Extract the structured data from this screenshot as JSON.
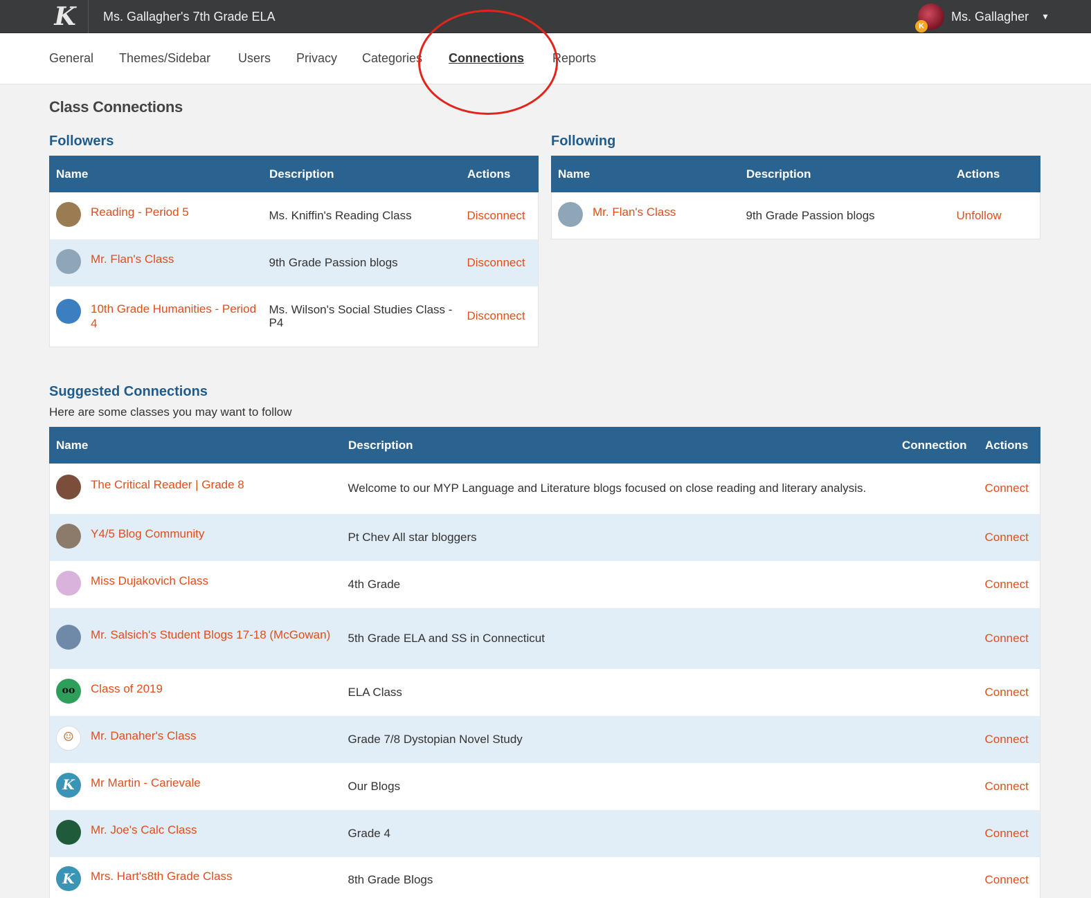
{
  "header": {
    "logo_letter": "K",
    "site_title": "Ms. Gallagher's 7th Grade ELA",
    "user_name": "Ms. Gallagher",
    "badge_letter": "K"
  },
  "nav": {
    "tabs": [
      "General",
      "Themes/Sidebar",
      "Users",
      "Privacy",
      "Categories",
      "Connections",
      "Reports"
    ],
    "active": "Connections"
  },
  "page_title": "Class Connections",
  "followers": {
    "title": "Followers",
    "columns": [
      "Name",
      "Description",
      "Actions"
    ],
    "rows": [
      {
        "name": "Reading - Period 5",
        "description": "Ms. Kniffin's Reading Class",
        "action": "Disconnect",
        "avatar": "book-icon",
        "color": "#9a7b52"
      },
      {
        "name": "Mr. Flan's Class",
        "description": "9th Grade Passion blogs",
        "action": "Disconnect",
        "avatar": "swirl-icon",
        "color": "#8fa6b8"
      },
      {
        "name": "10th Grade Humanities - Period 4",
        "description": "Ms. Wilson's Social Studies Class - P4",
        "action": "Disconnect",
        "avatar": "globe-icon",
        "color": "#3c7fc0"
      }
    ]
  },
  "following": {
    "title": "Following",
    "columns": [
      "Name",
      "Description",
      "Actions"
    ],
    "rows": [
      {
        "name": "Mr. Flan's Class",
        "description": "9th Grade Passion blogs",
        "action": "Unfollow",
        "avatar": "swirl-icon",
        "color": "#8fa6b8"
      }
    ]
  },
  "suggested": {
    "title": "Suggested Connections",
    "subtitle": "Here are some classes you may want to follow",
    "columns": [
      "Name",
      "Description",
      "Connection",
      "Actions"
    ],
    "rows": [
      {
        "name": "The Critical Reader | Grade 8",
        "description": "Welcome to our MYP Language and Literature blogs focused on close reading and literary analysis.",
        "action": "Connect",
        "avatar": "bookshelf-icon",
        "color": "#7a4e3a"
      },
      {
        "name": "Y4/5 Blog Community",
        "description": "Pt Chev All star bloggers",
        "action": "Connect",
        "avatar": "photo-icon",
        "color": "#8c7a6a"
      },
      {
        "name": "Miss Dujakovich Class",
        "description": "4th Grade",
        "action": "Connect",
        "avatar": "graduate-icon",
        "color": "#d9b3dc"
      },
      {
        "name": "Mr. Salsich's Student Blogs 17-18 (McGowan)",
        "description": "5th Grade ELA and SS in Connecticut",
        "action": "Connect",
        "avatar": "photo-icon",
        "color": "#6f8aa8"
      },
      {
        "name": "Class of 2019",
        "description": "ELA Class",
        "action": "Connect",
        "avatar": "glasses-icon",
        "color": "#2e9e5b"
      },
      {
        "name": "Mr. Danaher's Class",
        "description": "Grade 7/8 Dystopian Novel Study",
        "action": "Connect",
        "avatar": "face-icon",
        "color": "#f1f1f1"
      },
      {
        "name": "Mr Martin - Carievale",
        "description": "Our Blogs",
        "action": "Connect",
        "avatar": "k-logo-icon",
        "color": "#3a94b5"
      },
      {
        "name": "Mr. Joe's Calc Class",
        "description": "Grade 4",
        "action": "Connect",
        "avatar": "chalkboard-icon",
        "color": "#1f5b3a"
      },
      {
        "name": "Mrs. Hart's8th Grade Class",
        "description": "8th Grade Blogs",
        "action": "Connect",
        "avatar": "k-logo-icon",
        "color": "#3a94b5"
      }
    ]
  }
}
